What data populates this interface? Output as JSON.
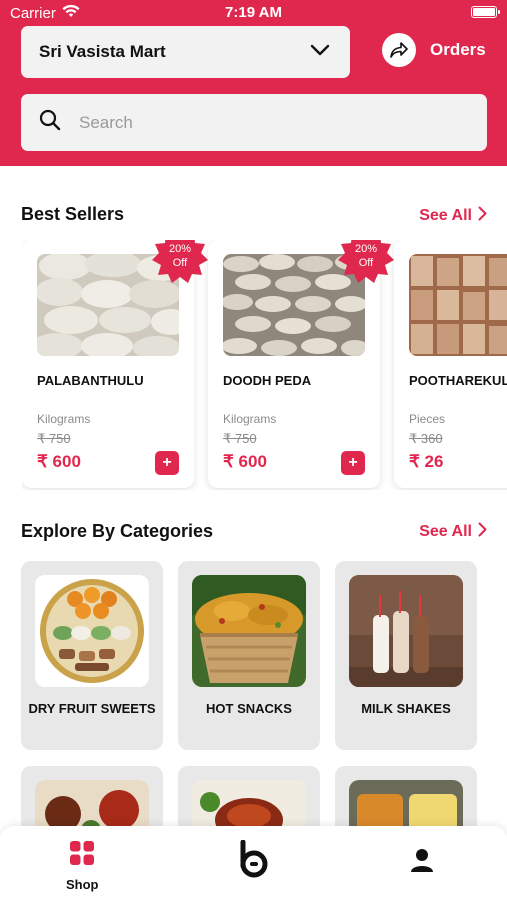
{
  "status": {
    "carrier": "Carrier",
    "time": "7:19 AM"
  },
  "header": {
    "store_name": "Sri Vasista Mart",
    "orders_label": "Orders",
    "search_placeholder": "Search"
  },
  "best_sellers": {
    "title": "Best Sellers",
    "see_all": "See All",
    "products": [
      {
        "name": "PALABANTHULU",
        "unit": "Kilograms",
        "mrp": "₹ 750",
        "price": "₹ 600",
        "badge_line1": "20%",
        "badge_line2": "Off"
      },
      {
        "name": "DOODH PEDA",
        "unit": "Kilograms",
        "mrp": "₹ 750",
        "price": "₹ 600",
        "badge_line1": "20%",
        "badge_line2": "Off"
      },
      {
        "name": "POOTHAREKULU",
        "unit": "Pieces",
        "mrp": "₹ 360",
        "price": "₹ 26"
      }
    ]
  },
  "categories": {
    "title": "Explore By Categories",
    "see_all": "See All",
    "items": [
      {
        "label": "DRY FRUIT SWEETS"
      },
      {
        "label": "HOT SNACKS"
      },
      {
        "label": "MILK SHAKES"
      }
    ]
  },
  "tabbar": {
    "shop_label": "Shop"
  },
  "colors": {
    "brand": "#e0284f",
    "card_bg": "#e8e8e8",
    "field_bg": "#f2f2f2"
  },
  "icons": [
    "wifi-icon",
    "battery-icon",
    "chevron-down-icon",
    "share-icon",
    "search-icon",
    "chevron-right-icon",
    "plus-icon",
    "grid-icon",
    "logo-icon",
    "user-icon"
  ]
}
